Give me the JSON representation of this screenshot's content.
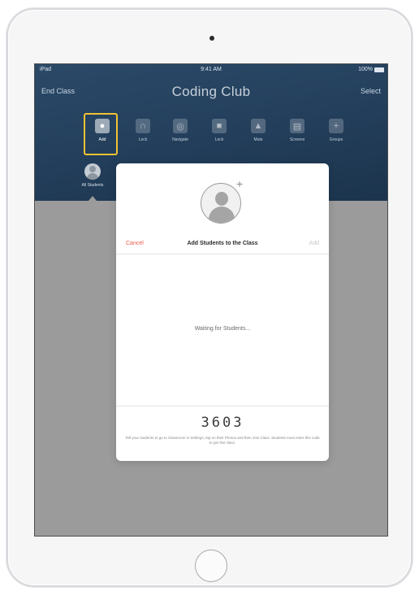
{
  "status_bar": {
    "carrier": "iPad",
    "time": "9:41 AM",
    "battery_percent": "100%"
  },
  "nav": {
    "left_label": "End Class",
    "title": "Coding Club",
    "right_label": "Select"
  },
  "toolbar": {
    "items": [
      {
        "label": "Add",
        "icon": "add-student-icon"
      },
      {
        "label": "Lock",
        "icon": "lock-icon"
      },
      {
        "label": "Navigate",
        "icon": "navigate-icon"
      },
      {
        "label": "Lock",
        "icon": "lock-screen-icon"
      },
      {
        "label": "Mute",
        "icon": "mute-icon"
      },
      {
        "label": "Screens",
        "icon": "screens-icon"
      },
      {
        "label": "Groups",
        "icon": "groups-icon"
      }
    ],
    "highlight_color": "#f2c233"
  },
  "student_chip": {
    "label": "All Students"
  },
  "modal": {
    "cancel_label": "Cancel",
    "title": "Add Students to the Class",
    "add_label": "Add",
    "waiting_text": "Waiting for Students...",
    "code": "3603",
    "help_text": "Tell your students to go to Classroom in Settings, tap on their Photos and then Join Class. Students must enter this code to join the class."
  },
  "colors": {
    "header_bg": "#24405d",
    "screen_bg": "#9b9b9b",
    "cancel": "#e85a48"
  }
}
